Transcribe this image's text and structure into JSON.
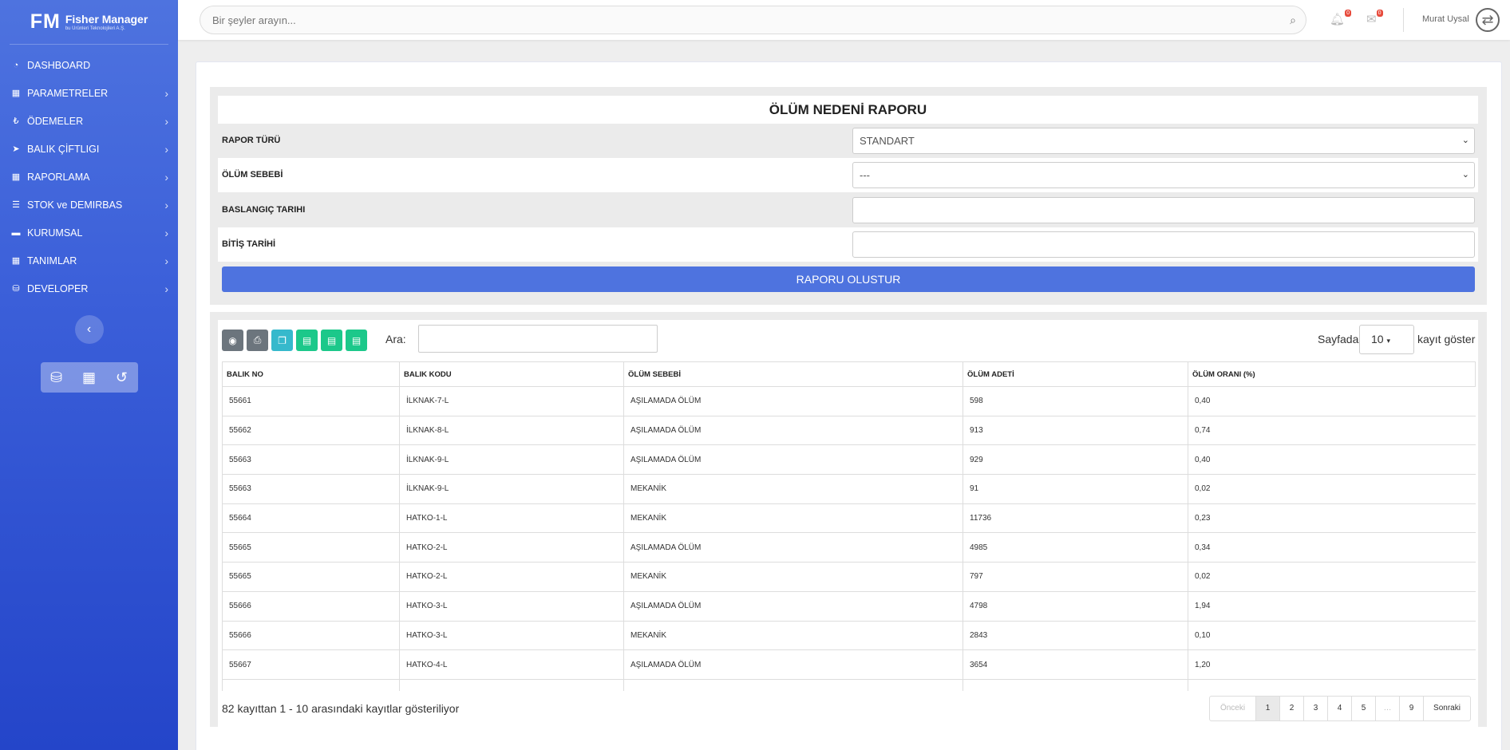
{
  "brand": {
    "logo": "FM",
    "name": "Fisher Manager",
    "sub": "bu Ürünleri Teknolojileri A.Ş."
  },
  "sidebar": {
    "items": [
      {
        "label": "DASHBOARD",
        "icon": "gauge-icon"
      },
      {
        "label": "PARAMETRELER",
        "icon": "table-icon"
      },
      {
        "label": "ÖDEMELER",
        "icon": "payment-icon"
      },
      {
        "label": "BALIK ÇİFTLIGI",
        "icon": "fish-icon"
      },
      {
        "label": "RAPORLAMA",
        "icon": "table-icon"
      },
      {
        "label": "STOK ve DEMIRBAS",
        "icon": "list-icon"
      },
      {
        "label": "KURUMSAL",
        "icon": "folder-icon"
      },
      {
        "label": "TANIMLAR",
        "icon": "table-icon"
      },
      {
        "label": "DEVELOPER",
        "icon": "database-icon"
      }
    ]
  },
  "topbar": {
    "search_placeholder": "Bir şeyler arayın...",
    "notif_count": "0",
    "msg_count": "0",
    "user": "Murat Uysal"
  },
  "form": {
    "title": "ÖLÜM NEDENİ RAPORU",
    "rapor_turu_label": "RAPOR TÜRÜ",
    "rapor_turu_value": "STANDART",
    "olum_sebebi_label": "ÖLÜM SEBEBİ",
    "olum_sebebi_value": "---",
    "baslangic_label": "BASLANGIÇ TARIHI",
    "bitis_label": "BİTİŞ TARİHİ",
    "submit": "RAPORU OLUSTUR"
  },
  "table": {
    "search_label": "Ara:",
    "sayfada": "Sayfada",
    "page_size": "10",
    "kayit": "kayıt göster",
    "headers": [
      "BALIK NO",
      "BALIK KODU",
      "ÖLÜM SEBEBİ",
      "ÖLÜM ADETİ",
      "ÖLÜM ORANI (%)"
    ],
    "rows": [
      [
        "55661",
        "İLKNAK-7-L",
        "AŞILAMADA ÖLÜM",
        "598",
        "0,40"
      ],
      [
        "55662",
        "İLKNAK-8-L",
        "AŞILAMADA ÖLÜM",
        "913",
        "0,74"
      ],
      [
        "55663",
        "İLKNAK-9-L",
        "AŞILAMADA ÖLÜM",
        "929",
        "0,40"
      ],
      [
        "55663",
        "İLKNAK-9-L",
        "MEKANİK",
        "91",
        "0,02"
      ],
      [
        "55664",
        "HATKO-1-L",
        "MEKANİK",
        "11736",
        "0,23"
      ],
      [
        "55665",
        "HATKO-2-L",
        "AŞILAMADA ÖLÜM",
        "4985",
        "0,34"
      ],
      [
        "55665",
        "HATKO-2-L",
        "MEKANİK",
        "797",
        "0,02"
      ],
      [
        "55666",
        "HATKO-3-L",
        "AŞILAMADA ÖLÜM",
        "4798",
        "1,94"
      ],
      [
        "55666",
        "HATKO-3-L",
        "MEKANİK",
        "2843",
        "0,10"
      ],
      [
        "55667",
        "HATKO-4-L",
        "AŞILAMADA ÖLÜM",
        "3654",
        "1,20"
      ]
    ],
    "info": "82 kayıttan 1 - 10 arasındaki kayıtlar gösteriliyor",
    "pager": {
      "prev": "Önceki",
      "pages": [
        "1",
        "2",
        "3",
        "4",
        "5",
        "…",
        "9"
      ],
      "next": "Sonraki"
    }
  }
}
